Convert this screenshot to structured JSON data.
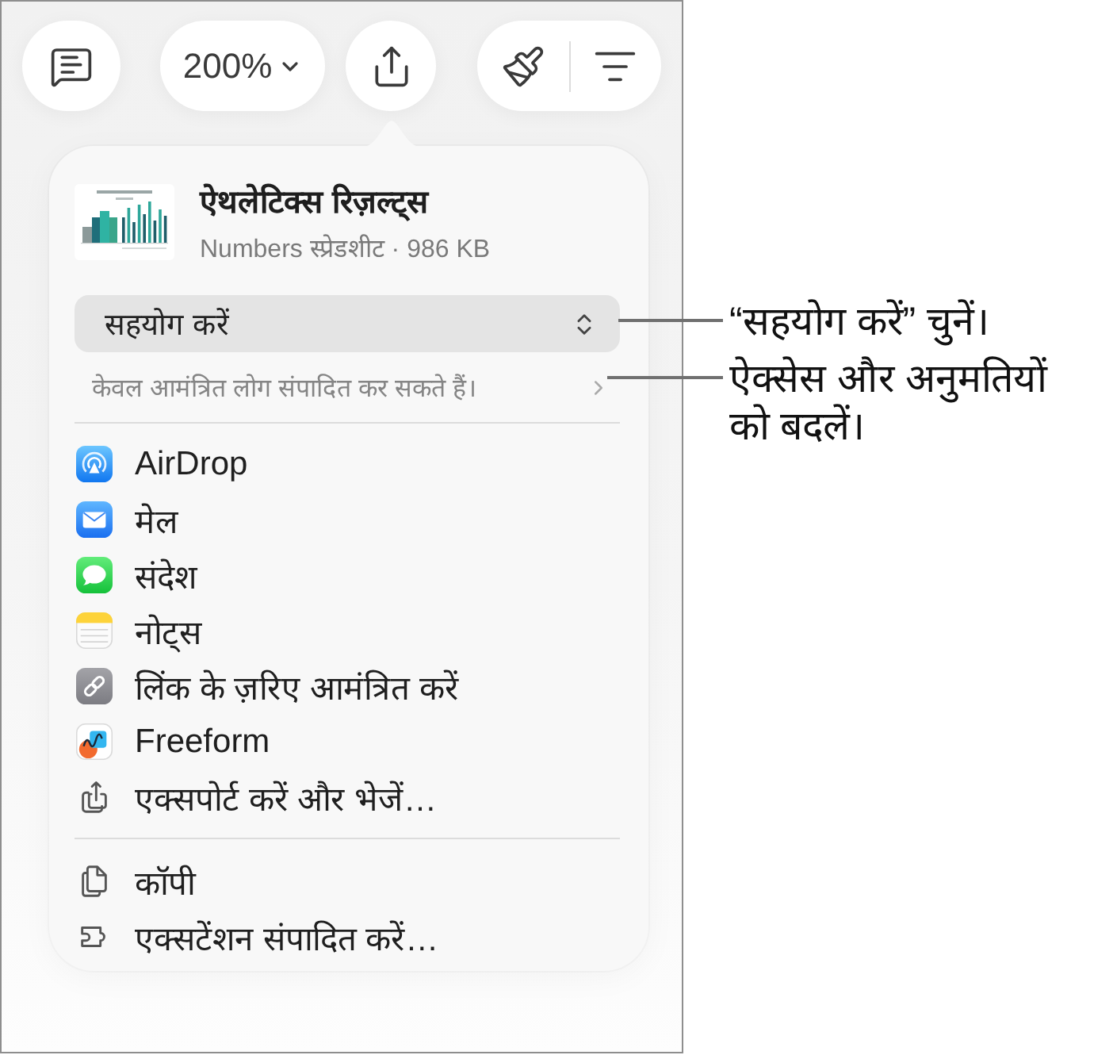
{
  "toolbar": {
    "zoom": "200%"
  },
  "popover": {
    "file": {
      "title": "ऐथलेटिक्स रिज़ल्ट्स",
      "subtitle": "Numbers स्प्रेडशीट · 986 KB"
    },
    "collaboration": {
      "mode": "सहयोग करें",
      "access": "केवल आमंत्रित लोग संपादित कर सकते हैं।"
    },
    "share_items": [
      {
        "kind": "airdrop",
        "label": "AirDrop"
      },
      {
        "kind": "mail",
        "label": "मेल"
      },
      {
        "kind": "messages",
        "label": "संदेश"
      },
      {
        "kind": "notes",
        "label": "नोट्स"
      },
      {
        "kind": "link",
        "label": "लिंक के ज़रिए आमंत्रित करें"
      },
      {
        "kind": "freeform",
        "label": "Freeform"
      },
      {
        "kind": "export",
        "label": "एक्सपोर्ट करें और भेजें…"
      }
    ],
    "actions": [
      {
        "kind": "copy",
        "label": "कॉपी"
      },
      {
        "kind": "extensions",
        "label": "एक्सटेंशन संपादित करें…"
      }
    ]
  },
  "callouts": [
    "“सहयोग करें” चुनें।",
    "ऐक्सेस और अनुमतियों को बदलें।"
  ]
}
